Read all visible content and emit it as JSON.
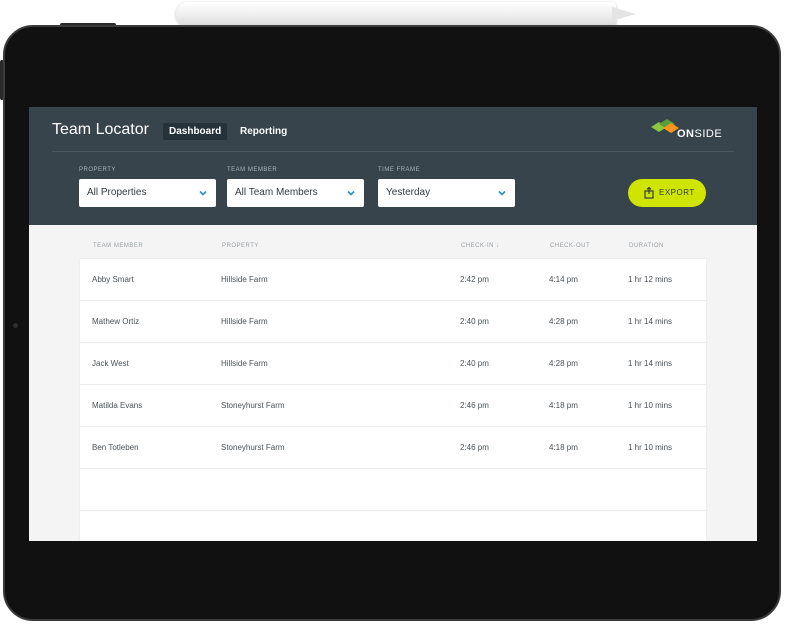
{
  "app": {
    "title": "Team Locator",
    "nav": [
      "Dashboard",
      "Reporting"
    ],
    "logo": {
      "bold": "ON",
      "rest": "SIDE"
    }
  },
  "filters": {
    "property": {
      "label": "PROPERTY",
      "value": "All Properties"
    },
    "team_member": {
      "label": "TEAM MEMBER",
      "value": "All Team Members"
    },
    "time_frame": {
      "label": "TIME FRAME",
      "value": "Yesterday"
    }
  },
  "export_label": "EXPORT",
  "table": {
    "headers": [
      "TEAM MEMBER",
      "PROPERTY",
      "CHECK-IN ↓",
      "CHECK-OUT",
      "DURATION"
    ],
    "rows": [
      [
        "Abby Smart",
        "Hillside Farm",
        "2:42 pm",
        "4:14 pm",
        "1 hr 12 mins"
      ],
      [
        "Mathew Ortiz",
        "Hillside Farm",
        "2:40 pm",
        "4:28 pm",
        "1 hr 14 mins"
      ],
      [
        "Jack West",
        "Hillside Farm",
        "2:40 pm",
        "4:28 pm",
        "1 hr 14 mins"
      ],
      [
        "Matilda Evans",
        "Stoneyhurst Farm",
        "2:46 pm",
        "4:18 pm",
        "1 hr 10 mins"
      ],
      [
        "Ben Totleben",
        "Stoneyhurst Farm",
        "2:46 pm",
        "4:18 pm",
        "1 hr 10 mins"
      ]
    ]
  },
  "colors": {
    "header": "#37444c",
    "accent": "#cfe400",
    "logo_green": "#8dc63f",
    "logo_orange": "#f7941d"
  }
}
